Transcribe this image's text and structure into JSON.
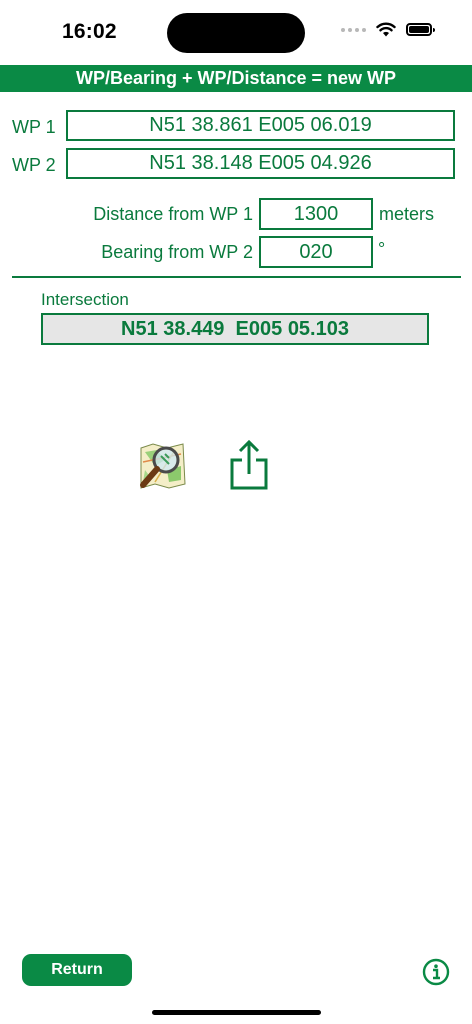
{
  "status_bar": {
    "time": "16:02"
  },
  "header": {
    "title": "WP/Bearing + WP/Distance = new WP"
  },
  "waypoints": {
    "wp1": {
      "label": "WP 1",
      "value": "N51 38.861 E005 06.019"
    },
    "wp2": {
      "label": "WP 2",
      "value": "N51 38.148 E005 04.926"
    }
  },
  "distance": {
    "label": "Distance from WP 1",
    "value": "1300",
    "unit": "meters"
  },
  "bearing": {
    "label": "Bearing from WP 2",
    "value": "020",
    "unit": "°"
  },
  "intersection": {
    "label": "Intersection",
    "value": "N51 38.449  E005 05.103"
  },
  "actions": {
    "map_icon": "map-search-icon",
    "share_icon": "share-icon",
    "info_icon": "info-icon"
  },
  "footer": {
    "return_label": "Return"
  },
  "colors": {
    "accent": "#0a8a45",
    "text": "#0a7a3d",
    "result_bg": "#e6e6e6"
  }
}
